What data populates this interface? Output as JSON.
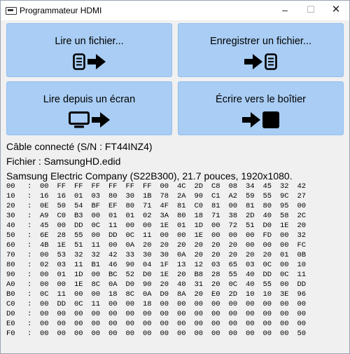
{
  "window": {
    "title": "Programmateur HDMI",
    "controls": {
      "minimize": "–",
      "maximize": "☐",
      "close": "✕"
    }
  },
  "buttons": {
    "read_file": "Lire un fichier...",
    "save_file": "Enregistrer un fichier...",
    "read_screen": "Lire depuis un écran",
    "write_box": "Écrire vers le boîtier"
  },
  "status": {
    "cable": "Câble connecté (S/N : FT44INZ4)",
    "file": "Fichier : SamsungHD.edid",
    "monitor": "Samsung Electric Company (S22B300),  21.7 pouces, 1920x1080."
  },
  "hex_rows": [
    {
      "addr": "00",
      "bytes": [
        "00",
        "FF",
        "FF",
        "FF",
        "FF",
        "FF",
        "FF",
        "00",
        "4C",
        "2D",
        "C8",
        "08",
        "34",
        "45",
        "32",
        "42"
      ]
    },
    {
      "addr": "10",
      "bytes": [
        "16",
        "16",
        "01",
        "03",
        "80",
        "30",
        "1B",
        "78",
        "2A",
        "90",
        "C1",
        "A2",
        "59",
        "55",
        "9C",
        "27"
      ]
    },
    {
      "addr": "20",
      "bytes": [
        "0E",
        "50",
        "54",
        "BF",
        "EF",
        "80",
        "71",
        "4F",
        "81",
        "C0",
        "81",
        "00",
        "81",
        "80",
        "95",
        "00"
      ]
    },
    {
      "addr": "30",
      "bytes": [
        "A9",
        "C0",
        "B3",
        "00",
        "01",
        "01",
        "02",
        "3A",
        "80",
        "18",
        "71",
        "38",
        "2D",
        "40",
        "58",
        "2C"
      ]
    },
    {
      "addr": "40",
      "bytes": [
        "45",
        "00",
        "DD",
        "0C",
        "11",
        "00",
        "00",
        "1E",
        "01",
        "1D",
        "00",
        "72",
        "51",
        "D0",
        "1E",
        "20"
      ]
    },
    {
      "addr": "50",
      "bytes": [
        "6E",
        "28",
        "55",
        "00",
        "DD",
        "0C",
        "11",
        "00",
        "00",
        "1E",
        "00",
        "00",
        "00",
        "FD",
        "00",
        "32"
      ]
    },
    {
      "addr": "60",
      "bytes": [
        "4B",
        "1E",
        "51",
        "11",
        "00",
        "0A",
        "20",
        "20",
        "20",
        "20",
        "20",
        "20",
        "00",
        "00",
        "00",
        "FC"
      ]
    },
    {
      "addr": "70",
      "bytes": [
        "00",
        "53",
        "32",
        "32",
        "42",
        "33",
        "30",
        "30",
        "0A",
        "20",
        "20",
        "20",
        "20",
        "20",
        "01",
        "0B"
      ]
    },
    {
      "addr": "80",
      "bytes": [
        "02",
        "03",
        "11",
        "B1",
        "46",
        "90",
        "04",
        "1F",
        "13",
        "12",
        "03",
        "65",
        "03",
        "0C",
        "00",
        "10"
      ]
    },
    {
      "addr": "90",
      "bytes": [
        "00",
        "01",
        "1D",
        "00",
        "BC",
        "52",
        "D0",
        "1E",
        "20",
        "B8",
        "28",
        "55",
        "40",
        "DD",
        "0C",
        "11"
      ]
    },
    {
      "addr": "A0",
      "bytes": [
        "00",
        "00",
        "1E",
        "8C",
        "0A",
        "D0",
        "90",
        "20",
        "40",
        "31",
        "20",
        "0C",
        "40",
        "55",
        "00",
        "DD"
      ]
    },
    {
      "addr": "B0",
      "bytes": [
        "0C",
        "11",
        "00",
        "00",
        "18",
        "8C",
        "0A",
        "D0",
        "8A",
        "20",
        "E0",
        "2D",
        "10",
        "10",
        "3E",
        "96"
      ]
    },
    {
      "addr": "C0",
      "bytes": [
        "00",
        "DD",
        "0C",
        "11",
        "00",
        "00",
        "18",
        "00",
        "00",
        "00",
        "00",
        "00",
        "00",
        "00",
        "00",
        "00"
      ]
    },
    {
      "addr": "D0",
      "bytes": [
        "00",
        "00",
        "00",
        "00",
        "00",
        "00",
        "00",
        "00",
        "00",
        "00",
        "00",
        "00",
        "00",
        "00",
        "00",
        "00"
      ]
    },
    {
      "addr": "E0",
      "bytes": [
        "00",
        "00",
        "00",
        "00",
        "00",
        "00",
        "00",
        "00",
        "00",
        "00",
        "00",
        "00",
        "00",
        "00",
        "00",
        "00"
      ]
    },
    {
      "addr": "F0",
      "bytes": [
        "00",
        "00",
        "00",
        "00",
        "00",
        "00",
        "00",
        "00",
        "00",
        "00",
        "00",
        "00",
        "00",
        "00",
        "00",
        "50"
      ]
    }
  ]
}
